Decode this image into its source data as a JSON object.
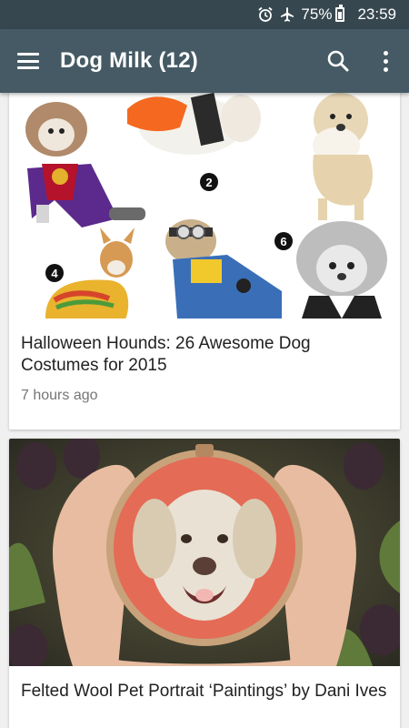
{
  "status_bar": {
    "battery_percent": "75%",
    "time": "23:59",
    "icons": [
      "alarm-icon",
      "airplane-icon",
      "battery-icon"
    ]
  },
  "app_bar": {
    "title": "Dog Milk (12)",
    "icons": [
      "menu-icon",
      "search-icon",
      "more-vert-icon"
    ]
  },
  "feed": {
    "articles": [
      {
        "title": "Halloween Hounds: 26 Awesome Dog Costumes for 2015",
        "time": "7 hours ago",
        "image": "collage of dogs in halloween costumes",
        "badges": [
          "2",
          "4",
          "6"
        ]
      },
      {
        "title": "Felted Wool Pet Portrait ‘Paintings’ by Dani Ives",
        "image": "hands holding embroidery hoop with felted dog portrait"
      }
    ]
  },
  "colors": {
    "status_bar": "#37474f",
    "app_bar": "#455a64",
    "background": "#f0f0f0",
    "card": "#ffffff",
    "title_text": "#212121",
    "meta_text": "#757575"
  }
}
